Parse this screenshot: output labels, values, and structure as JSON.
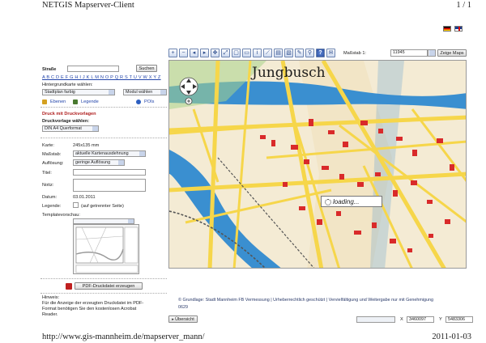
{
  "page": {
    "title": "NETGIS Mapserver-Client",
    "page_number": "1 / 1",
    "url": "http://www.gis-mannheim.de/mapserver_mann/",
    "date": "2011-01-03"
  },
  "languages": [
    "de-flag-icon",
    "en-flag-icon"
  ],
  "sidebar": {
    "street_label": "Straße",
    "search_button": "Suchen",
    "alphabet": "A B C D E F G H I J K L M N O P Q R S T U V W X Y Z",
    "basemap_label": "Hintergrundkarte wählen:",
    "basemap_value": "Stadtplan farbig",
    "module_value": "Modul wählen",
    "layers_label": "Ebenen",
    "legend_label": "Legende",
    "pois_label": "POIs",
    "print_heading": "Druck mit Druckvorlagen",
    "template_label": "Druckvorlage wählen:",
    "template_value": "DIN A4 Querformat",
    "card_label": "Karte:",
    "card_value": "245x135 mm",
    "scale_label": "Maßstab:",
    "scale_value": "aktuelle Kartenausdehnung",
    "resolution_label": "Auflösung:",
    "resolution_value": "geringe Auflösung",
    "title_label": "Titel:",
    "notes_label": "Notiz:",
    "date_label": "Datum:",
    "date_value": "03.01.2011",
    "legend_field_label": "Legende:",
    "legend_option": "(auf getrennter Seite)",
    "preview_label": "Templatevorschau:",
    "pdf_button": "PDF-Druckdatei erzeugen",
    "hint_title": "Hinweis:",
    "hint_text": [
      "Für die Anzeige der erzeugten Druckdatei im PDF-",
      "Format benötigen Sie den kostenlosen Acrobat",
      "Reader."
    ]
  },
  "toolbar": {
    "icons": [
      "zoom-in-icon",
      "zoom-out-icon",
      "zoom-back-icon",
      "zoom-forward-icon",
      "pan-icon",
      "full-extent-icon",
      "zoom-box-icon",
      "select-icon",
      "info-icon",
      "measure-icon",
      "print-icon",
      "pdf-icon",
      "edit-icon",
      "link-icon",
      "help-icon",
      "mail-icon"
    ],
    "scale_label": "Maßstab 1:",
    "scale_value": "11945",
    "apply_button": "Zeige Maps"
  },
  "map": {
    "district_label": "Jungbusch",
    "loading_text": "loading...",
    "colors": {
      "river": "#3a8fd0",
      "land": "#f4ebd4",
      "buildings": "#d92a2a",
      "green": "#a8d48a",
      "roads": "#f6d64a",
      "rail": "#555555"
    }
  },
  "footer": {
    "notice_line1": "© Grundlage: Stadt Mannheim FB Vermessung | Urheberrechtlich geschützt | Vervielfältigung und Weitergabe nur mit Genehmigung",
    "notice_line2": "0629",
    "overview_button": "Übersicht",
    "x_label": "X",
    "x_value": "3460097",
    "y_label": "Y",
    "y_value": "5483306"
  }
}
